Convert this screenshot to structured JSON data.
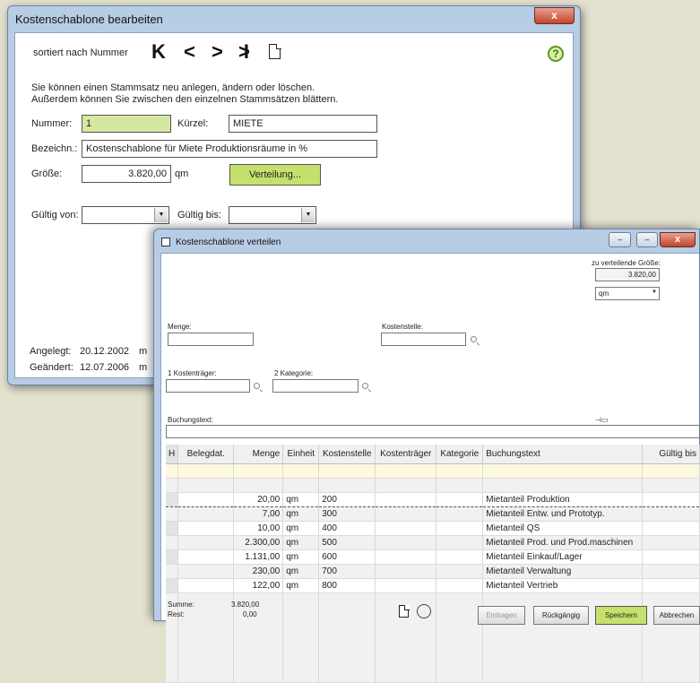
{
  "win1": {
    "title": "Kostenschablone bearbeiten",
    "close_label": "x",
    "sort_label": "sortiert nach Nummer",
    "nav": {
      "first": "K",
      "prev": "<",
      "next": ">",
      "last": "!K"
    },
    "help_label": "?",
    "info_line1": "Sie können einen Stammsatz neu anlegen, ändern oder löschen.",
    "info_line2": "Außerdem können Sie zwischen den einzelnen Stammsätzen blättern.",
    "nummer_label": "Nummer:",
    "nummer_value": "1",
    "kuerzel_label": "Kürzel:",
    "kuerzel_value": "MIETE",
    "bezeichnung_label": "Bezeichn.:",
    "bezeichnung_value": "Kostenschablone für Miete Produktionsräume in %",
    "groesse_label": "Größe:",
    "groesse_value": "3.820,00",
    "groesse_unit": "qm",
    "verteilung_label": "Verteilung...",
    "gueltig_von_label": "Gültig von:",
    "gueltig_bis_label": "Gültig bis:",
    "angelegt_label": "Angelegt:",
    "angelegt_value": "20.12.2002",
    "angelegt_user": "m",
    "geaendert_label": "Geändert:",
    "geaendert_value": "12.07.2006",
    "geaendert_user": "m"
  },
  "win2": {
    "title": "Kostenschablone verteilen",
    "minimize_label": "–",
    "maximize_label": "□",
    "close_label": "x",
    "zu_verteilende_label": "zu verteilende Größe:",
    "zu_verteilende_value": "3.820,00",
    "unit_value": "qm",
    "menge_label": "Menge:",
    "kostenstelle_label": "Kostenstelle:",
    "kostentraeger_label": "1 Kostenträger:",
    "kategorie_label": "2 Kategorie:",
    "buchungstext_label": "Buchungstext:",
    "columns": [
      "H",
      "Belegdat.",
      "Menge",
      "Einheit",
      "Kostenstelle",
      "Kostenträger",
      "Kategorie",
      "Buchungstext",
      "Gültig bis"
    ],
    "rows": [
      {
        "menge": "20,00",
        "einheit": "qm",
        "kostenstelle": "200",
        "buchungstext": "Mietanteil Produktion"
      },
      {
        "menge": "7,00",
        "einheit": "qm",
        "kostenstelle": "300",
        "buchungstext": "Mietanteil Entw. und Prototyp."
      },
      {
        "menge": "10,00",
        "einheit": "qm",
        "kostenstelle": "400",
        "buchungstext": "Mietanteil QS"
      },
      {
        "menge": "2.300,00",
        "einheit": "qm",
        "kostenstelle": "500",
        "buchungstext": "Mietanteil Prod. und Prod.maschinen"
      },
      {
        "menge": "1.131,00",
        "einheit": "qm",
        "kostenstelle": "600",
        "buchungstext": "Mietanteil Einkauf/Lager"
      },
      {
        "menge": "230,00",
        "einheit": "qm",
        "kostenstelle": "700",
        "buchungstext": "Mietanteil Verwaltung"
      },
      {
        "menge": "122,00",
        "einheit": "qm",
        "kostenstelle": "800",
        "buchungstext": "Mietanteil Vertrieb"
      }
    ],
    "summe_label": "Summe:",
    "summe_value": "3.820,00",
    "rest_label": "Rest:",
    "rest_value": "0,00",
    "buttons": {
      "eintragen": "Eintragen",
      "rueckgaengig": "Rückgängig",
      "speichern": "Speichern",
      "abbrechen": "Abbrechen"
    }
  }
}
